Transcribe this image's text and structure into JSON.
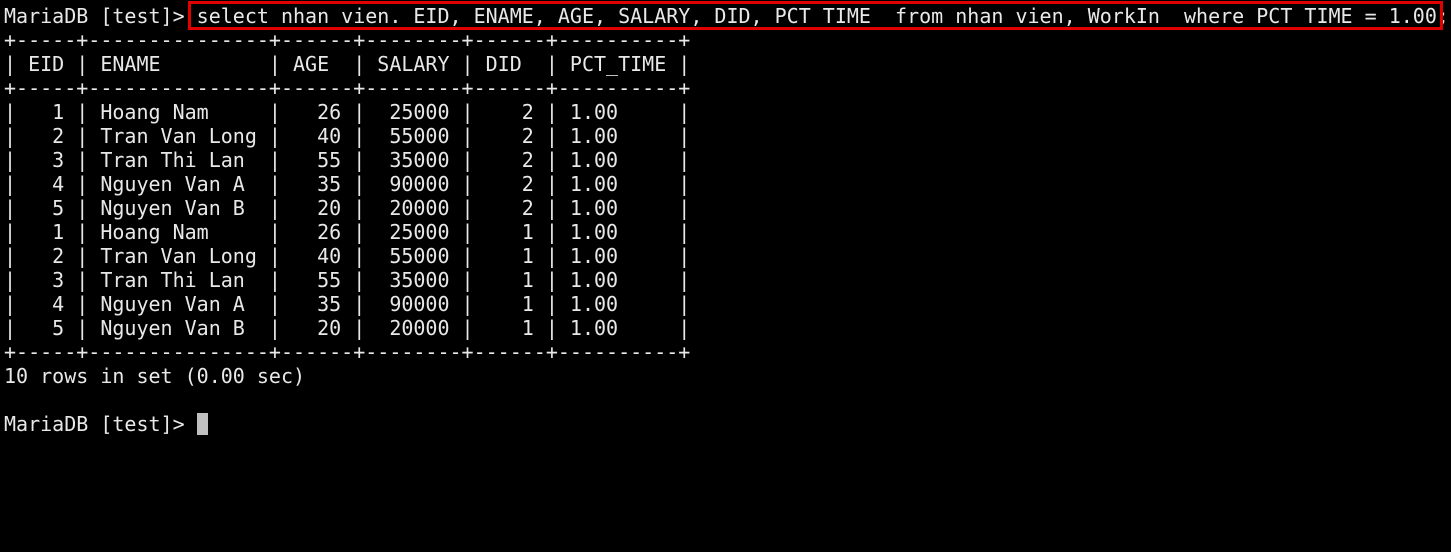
{
  "prompt": "MariaDB [test]> ",
  "command": "select nhan_vien. EID, ENAME, AGE, SALARY, DID, PCT_TIME  from nhan_vien, WorkIn  where PCT_TIME = 1.00;",
  "table": {
    "border": "+-----+---------------+------+--------+------+----------+",
    "header": "| EID | ENAME         | AGE  | SALARY | DID  | PCT_TIME |",
    "rows": [
      "|   1 | Hoang Nam     |   26 |  25000 |    2 | 1.00     |",
      "|   2 | Tran Van Long |   40 |  55000 |    2 | 1.00     |",
      "|   3 | Tran Thi Lan  |   55 |  35000 |    2 | 1.00     |",
      "|   4 | Nguyen Van A  |   35 |  90000 |    2 | 1.00     |",
      "|   5 | Nguyen Van B  |   20 |  20000 |    2 | 1.00     |",
      "|   1 | Hoang Nam     |   26 |  25000 |    1 | 1.00     |",
      "|   2 | Tran Van Long |   40 |  55000 |    1 | 1.00     |",
      "|   3 | Tran Thi Lan  |   55 |  35000 |    1 | 1.00     |",
      "|   4 | Nguyen Van A  |   35 |  90000 |    1 | 1.00     |",
      "|   5 | Nguyen Van B  |   20 |  20000 |    1 | 1.00     |"
    ]
  },
  "result_summary": "10 rows in set (0.00 sec)",
  "colors": {
    "background": "#000000",
    "text": "#e8e8e8",
    "highlight_border": "#e00000",
    "cursor": "#c0c0c0"
  }
}
